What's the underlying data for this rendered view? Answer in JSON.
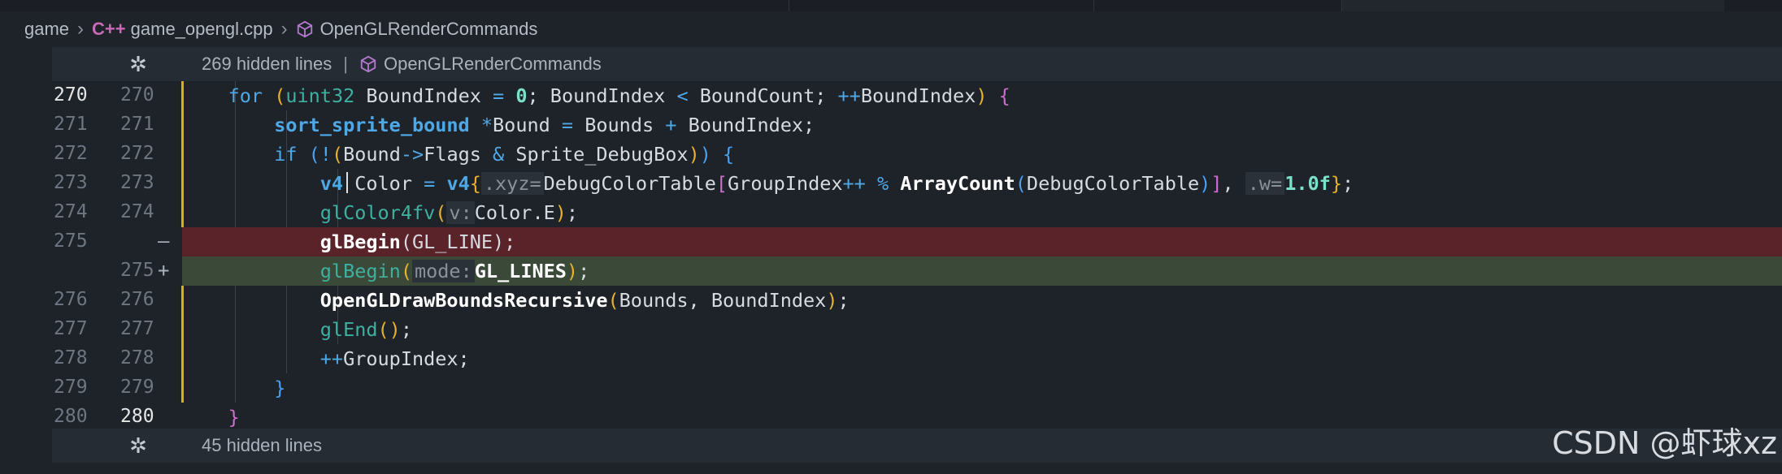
{
  "breadcrumb": {
    "items": [
      "game",
      "game_opengl.cpp",
      "OpenGLRenderCommands"
    ],
    "cpp_icon": "C++"
  },
  "hidden_top": {
    "count_label": "269 hidden lines",
    "separator": "|",
    "scope": "OpenGLRenderCommands"
  },
  "hidden_bottom": {
    "count_label": "45 hidden lines"
  },
  "lines": [
    {
      "old": "270",
      "new": "270"
    },
    {
      "old": "271",
      "new": "271"
    },
    {
      "old": "272",
      "new": "272"
    },
    {
      "old": "273",
      "new": "273"
    },
    {
      "old": "274",
      "new": "274"
    },
    {
      "old": "275",
      "new": "",
      "mark": "—"
    },
    {
      "old": "",
      "new": "275",
      "mark": "+"
    },
    {
      "old": "276",
      "new": "276"
    },
    {
      "old": "277",
      "new": "277"
    },
    {
      "old": "278",
      "new": "278"
    },
    {
      "old": "279",
      "new": "279"
    },
    {
      "old": "280",
      "new": "280"
    }
  ],
  "watermark": "CSDN @虾球xz",
  "colors": {
    "deleted": "#5a2229",
    "added": "#3b4a38",
    "change_bar": "#d8b11a"
  }
}
